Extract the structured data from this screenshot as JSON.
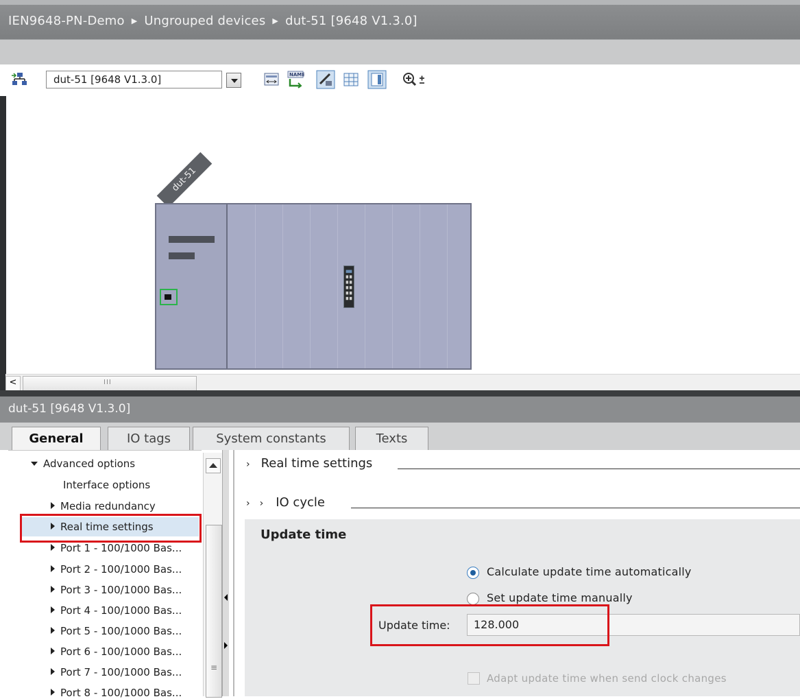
{
  "breadcrumb": {
    "project": "IEN9648-PN-Demo",
    "group": "Ungrouped devices",
    "device": "dut-51 [9648 V1.3.0]",
    "separator": "▶"
  },
  "toolbar": {
    "device_select_value": "dut-51 [9648 V1.3.0]"
  },
  "canvas": {
    "device_tag": "dut-51"
  },
  "properties": {
    "title": "dut-51 [9648 V1.3.0]",
    "tabs": [
      "General",
      "IO tags",
      "System constants",
      "Texts"
    ],
    "active_tab": "General"
  },
  "nav": {
    "items": [
      "Advanced options",
      "Interface options",
      "Media redundancy",
      "Real time settings",
      "Port 1 - 100/1000 Bas...",
      "Port 2 - 100/1000 Bas...",
      "Port 3 - 100/1000 Bas...",
      "Port 4 - 100/1000 Bas...",
      "Port 5 - 100/1000 Bas...",
      "Port 6 - 100/1000 Bas...",
      "Port 7 - 100/1000 Bas...",
      "Port 8 - 100/1000 Bas..."
    ],
    "selected": "Real time settings"
  },
  "content": {
    "section1": "Real time settings",
    "section2": "IO cycle",
    "update_title": "Update time",
    "radio_auto": "Calculate update time automatically",
    "radio_manual": "Set update time manually",
    "update_label": "Update time:",
    "update_value": "128.000",
    "adapt_label": "Adapt update time when send clock changes"
  },
  "colors": {
    "highlight_red": "#d9141a",
    "selection_blue": "#d8e6f3",
    "port_green": "#2bb34b"
  }
}
